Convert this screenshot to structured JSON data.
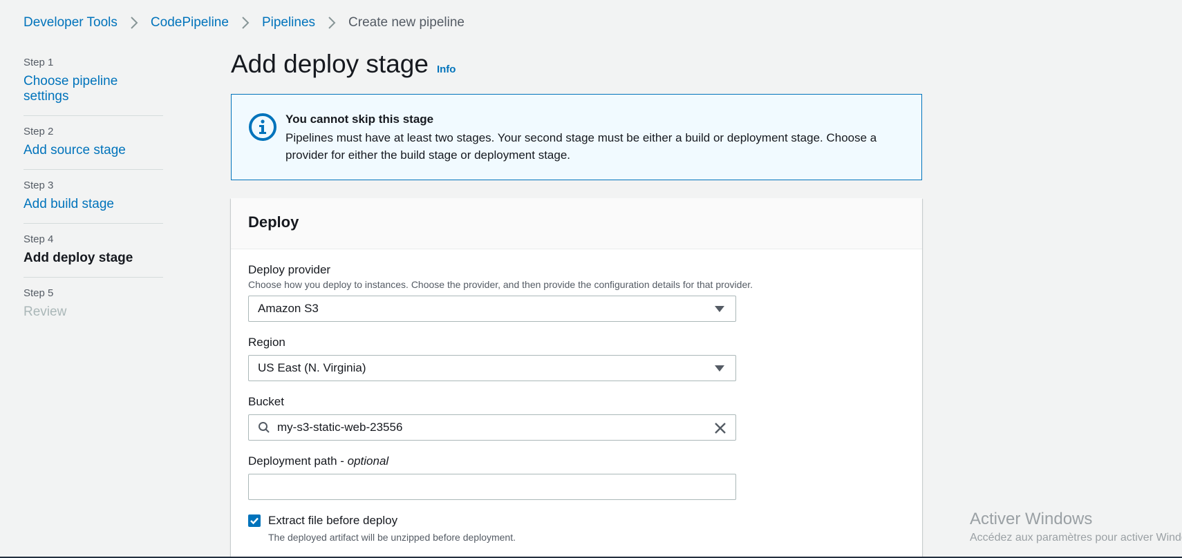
{
  "breadcrumb": [
    "Developer Tools",
    "CodePipeline",
    "Pipelines",
    "Create new pipeline"
  ],
  "steps": [
    {
      "num": "Step 1",
      "label": "Choose pipeline settings"
    },
    {
      "num": "Step 2",
      "label": "Add source stage"
    },
    {
      "num": "Step 3",
      "label": "Add build stage"
    },
    {
      "num": "Step 4",
      "label": "Add deploy stage"
    },
    {
      "num": "Step 5",
      "label": "Review"
    }
  ],
  "page": {
    "title": "Add deploy stage",
    "info": "Info"
  },
  "alert": {
    "title": "You cannot skip this stage",
    "body": "Pipelines must have at least two stages. Your second stage must be either a build or deployment stage. Choose a provider for either the build stage or deployment stage."
  },
  "panel": {
    "title": "Deploy",
    "provider_label": "Deploy provider",
    "provider_desc": "Choose how you deploy to instances. Choose the provider, and then provide the configuration details for that provider.",
    "provider_value": "Amazon S3",
    "region_label": "Region",
    "region_value": "US East (N. Virginia)",
    "bucket_label": "Bucket",
    "bucket_value": "my-s3-static-web-23556",
    "path_label": "Deployment path - ",
    "path_optional": "optional",
    "path_value": "",
    "extract_label": "Extract file before deploy",
    "extract_desc": "The deployed artifact will be unzipped before deployment."
  },
  "watermark": {
    "title": "Activer Windows",
    "sub": "Accédez aux paramètres pour activer Windows."
  },
  "colors": {
    "accent": "#0073bb",
    "background": "#f2f3f3",
    "alert_bg": "#f1faff"
  }
}
